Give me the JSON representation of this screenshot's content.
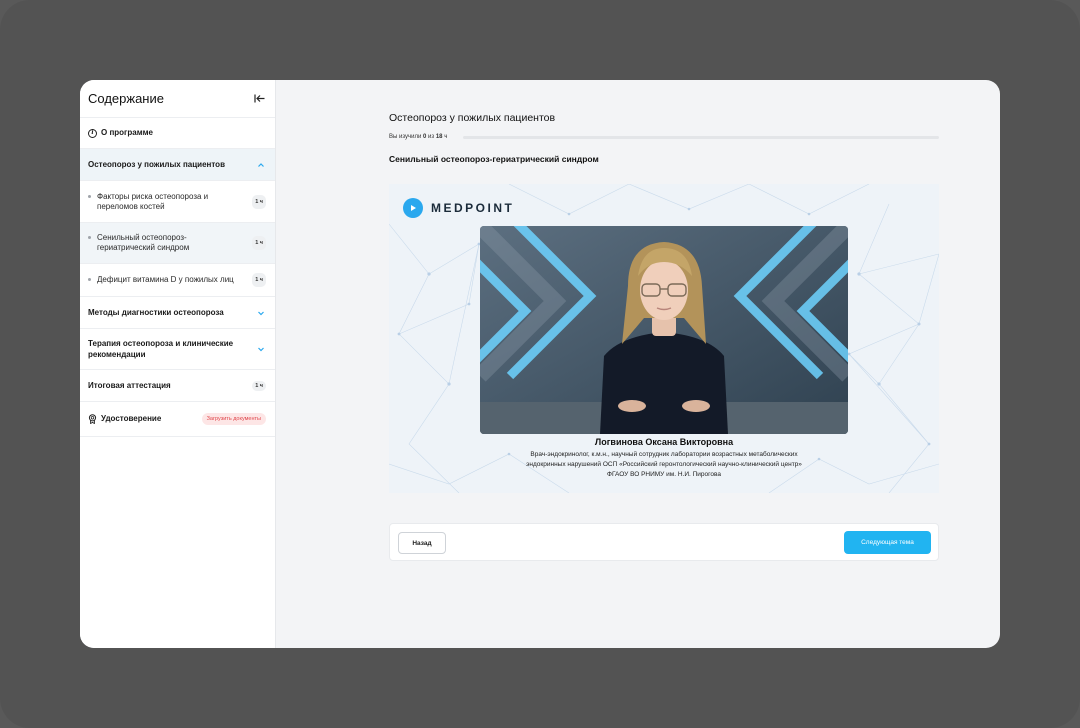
{
  "sidebar": {
    "title": "Содержание",
    "about_label": "О программе",
    "active_section": "Остеопороз у пожилых пациентов",
    "sub_items": [
      {
        "label": "Факторы риска остеопороза и переломов костей",
        "hours": "1 ч"
      },
      {
        "label": "Сенильный остеопороз-гериатрический синдром",
        "hours": "1 ч"
      },
      {
        "label": "Дефицит витамина D у пожилых лиц",
        "hours": "1 ч"
      }
    ],
    "sections": [
      {
        "label": "Методы диагностики остеопороза"
      },
      {
        "label": "Терапия остеопороза и клинические рекомендации"
      }
    ],
    "final": {
      "label": "Итоговая аттестация",
      "hours": "1 ч"
    },
    "certificate": {
      "label": "Удостоверение",
      "badge": "Загрузить документы"
    }
  },
  "main": {
    "course_title": "Остеопороз у пожилых пациентов",
    "progress": {
      "prefix": "Вы изучили",
      "done": "0",
      "middle": "из",
      "total": "18",
      "unit": "ч",
      "fraction": 0
    },
    "topic_title": "Сенильный остеопороз-гериатрический синдром",
    "video": {
      "brand": "MEDPOINT",
      "speaker_name": "Логвинова Оксана Викторовна",
      "speaker_desc_1": "Врач-эндокринолог, к.м.н., научный сотрудник лаборатории возрастных метаболических",
      "speaker_desc_2": "эндокринных нарушений ОСП «Российский геронтологический научно-клинический центр»",
      "speaker_desc_3": "ФГАОУ ВО РНИМУ им. Н.И. Пирогова"
    },
    "nav": {
      "back_label": "Назад",
      "next_label": "Следующая тема"
    }
  },
  "colors": {
    "accent": "#21b4f1",
    "danger_text": "#e0474c",
    "danger_bg": "#fde6e6"
  }
}
